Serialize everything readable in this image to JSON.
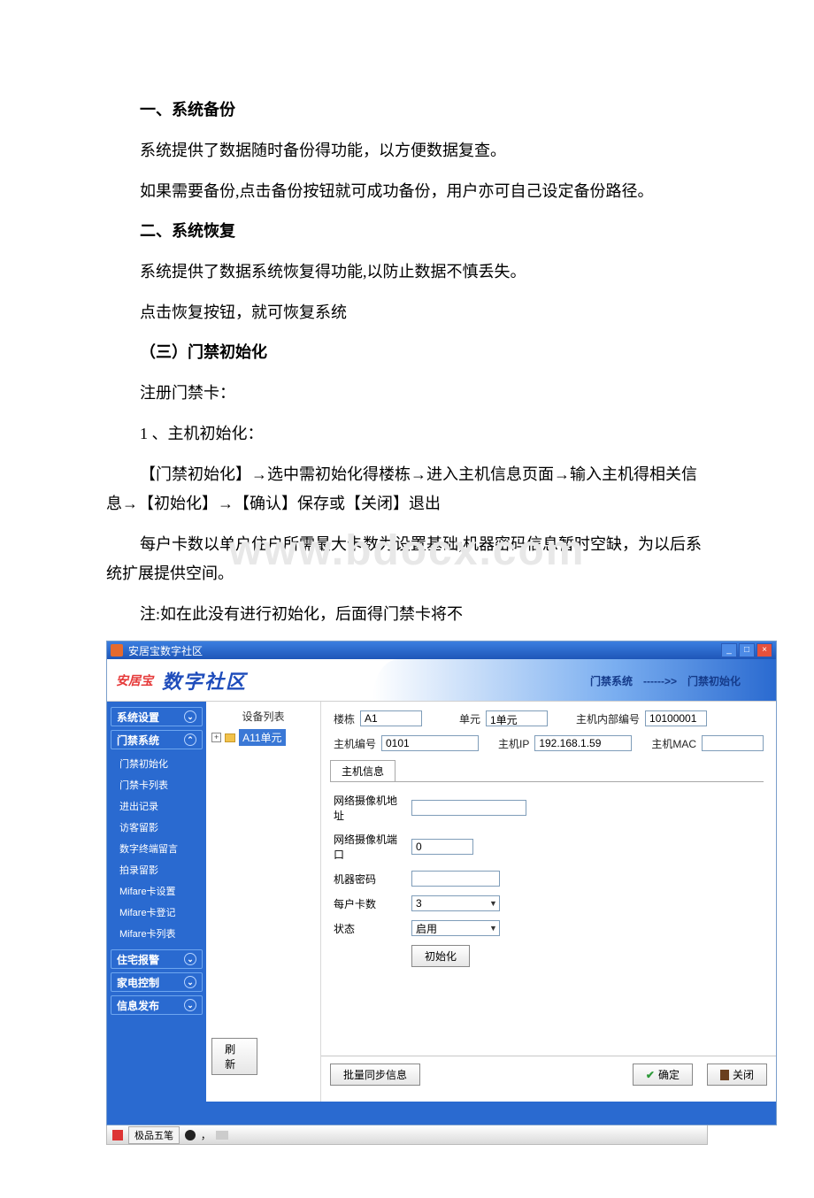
{
  "doc": {
    "h1": "一、系统备份",
    "p1": "系统提供了数据随时备份得功能，以方便数据复查。",
    "p2": "如果需要备份,点击备份按钮就可成功备份，用户亦可自己设定备份路径。",
    "h2": "二、系统恢复",
    "p3": "系统提供了数据系统恢复得功能,以防止数据不慎丢失。",
    "p4": "点击恢复按钮，就可恢复系统",
    "h3": "（三）门禁初始化",
    "p5": "注册门禁卡：",
    "p6": "1 、主机初始化：",
    "p7": "【门禁初始化】→选中需初始化得楼栋→进入主机信息页面→输入主机得相关信息→【初始化】→【确认】保存或【关闭】退出",
    "p8": "每户卡数以单户住户所需最大卡数为设置基础;机器密码信息暂时空缺，为以后系统扩展提供空间。",
    "p9": "注:如在此没有进行初始化，后面得门禁卡将不"
  },
  "watermark": "www.bdocx.com",
  "app": {
    "title": "安居宝数字社区",
    "brand_small": "安居宝",
    "brand_main": "数字社区",
    "breadcrumb": "门禁系统　------>>　门禁初始化",
    "sidebar": {
      "groups": [
        {
          "label": "系统设置",
          "expanded": false
        },
        {
          "label": "门禁系统",
          "expanded": true,
          "items": [
            "门禁初始化",
            "门禁卡列表",
            "进出记录",
            "访客留影",
            "数字终端留言",
            "拍录留影",
            "Mifare卡设置",
            "Mifare卡登记",
            "Mifare卡列表"
          ]
        },
        {
          "label": "住宅报警",
          "expanded": false
        },
        {
          "label": "家电控制",
          "expanded": false
        },
        {
          "label": "信息发布",
          "expanded": false
        }
      ]
    },
    "tree": {
      "header": "设备列表",
      "node_label": "A11单元"
    },
    "form": {
      "labels": {
        "building": "楼栋",
        "unit": "单元",
        "internal_no": "主机内部编号",
        "host_no": "主机编号",
        "host_ip": "主机IP",
        "host_mac": "主机MAC",
        "tab_host": "主机信息",
        "cam_addr": "网络摄像机地址",
        "cam_port": "网络摄像机端口",
        "machine_pwd": "机器密码",
        "cards_per": "每户卡数",
        "status": "状态",
        "init_btn": "初始化",
        "refresh_btn": "刷新",
        "batch_btn": "批量同步信息",
        "ok_btn": "确定",
        "close_btn": "关闭"
      },
      "values": {
        "building": "A1",
        "unit": "1单元",
        "internal_no": "10100001",
        "host_no": "0101",
        "host_ip": "192.168.1.59",
        "host_mac": "",
        "cam_addr": "",
        "cam_port": "0",
        "machine_pwd": "",
        "cards_per": "3",
        "status": "启用"
      }
    },
    "taskbar": {
      "ime": "极品五笔"
    }
  }
}
